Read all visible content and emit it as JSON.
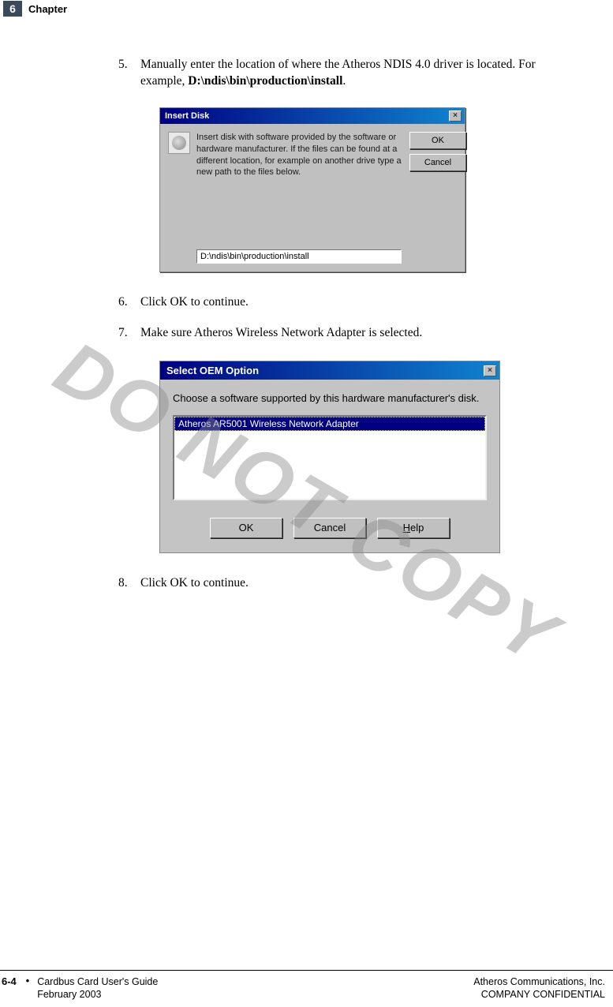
{
  "header": {
    "chapter_num": "6",
    "chapter_label": "Chapter"
  },
  "steps": {
    "s5_num": "5.",
    "s5_text_a": "Manually enter the location of where the Atheros NDIS 4.0 driver is located. For example, ",
    "s5_text_b": "D:\\ndis\\bin\\production\\install",
    "s5_text_c": ".",
    "s6_num": "6.",
    "s6_text": "Click OK to continue.",
    "s7_num": "7.",
    "s7_text": "Make sure Atheros Wireless Network Adapter is selected.",
    "s8_num": "8.",
    "s8_text": "Click OK to continue."
  },
  "dialog1": {
    "title": "Insert Disk",
    "close": "×",
    "message": "Insert disk with software provided by the software or hardware manufacturer.  If the files can be found at a different location, for example on another drive type a new path to the files below.",
    "path_value": "D:\\ndis\\bin\\production\\install",
    "ok": "OK",
    "cancel": "Cancel"
  },
  "dialog2": {
    "title": "Select OEM Option",
    "close": "×",
    "prompt": "Choose a software supported by this hardware manufacturer's disk.",
    "list_item": "Atheros AR5001 Wireless Network Adapter",
    "ok": "OK",
    "cancel": "Cancel",
    "help_u": "H",
    "help_rest": "elp"
  },
  "watermark": "DO NOT COPY",
  "footer": {
    "page": "6-4",
    "guide": "Cardbus Card User's Guide",
    "date": "February 2003",
    "company": "Atheros Communications, Inc.",
    "confidential": "COMPANY CONFIDENTIAL"
  }
}
